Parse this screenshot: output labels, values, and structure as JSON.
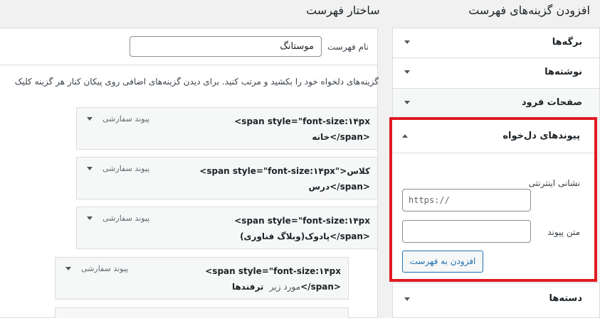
{
  "add_items": {
    "title": "افزودن گزینه‌های فهرست",
    "sections": [
      {
        "label": "برگه‌ها"
      },
      {
        "label": "نوشته‌ها"
      },
      {
        "label": "صفحات فرود"
      }
    ],
    "custom_links": {
      "title": "پیوندهای دل‌خواه",
      "url_label": "نشانی اینترنتی",
      "url_placeholder": "https://",
      "text_label": "متن پیوند",
      "add_button": "افزودن به فهرست"
    },
    "categories": {
      "label": "دسته‌ها"
    }
  },
  "structure": {
    "title": "ساختار فهرست",
    "name_label": "نام فهرست",
    "name_value": "موستانگ",
    "help_text": "گزینه‌های دلخواه خود را بکشید و مرتب کنید. برای دیدن گزینه‌های اضافی روی پیکان کنار هر گزینه کلیک",
    "items": [
      {
        "line1": "<span style=\"font-size:۱۴px",
        "line2": "خانه</span>",
        "type": "پیوند سفارشی"
      },
      {
        "line1": "<span style=\"font-size:۱۴px\">کلاس",
        "line2": "درس</span>",
        "type": "پیوند سفارشی"
      },
      {
        "line1": "<span style=\"font-size:۱۴px",
        "line2": "پادوک(وبلاگ فناوری)</span>",
        "type": "پیوند سفارشی"
      },
      {
        "line1": "<span style=\"font-size:۱۴px",
        "line2": "ترفندها</span>",
        "sub": "مورد زیر",
        "type": "پیوند سفارشی"
      }
    ]
  }
}
